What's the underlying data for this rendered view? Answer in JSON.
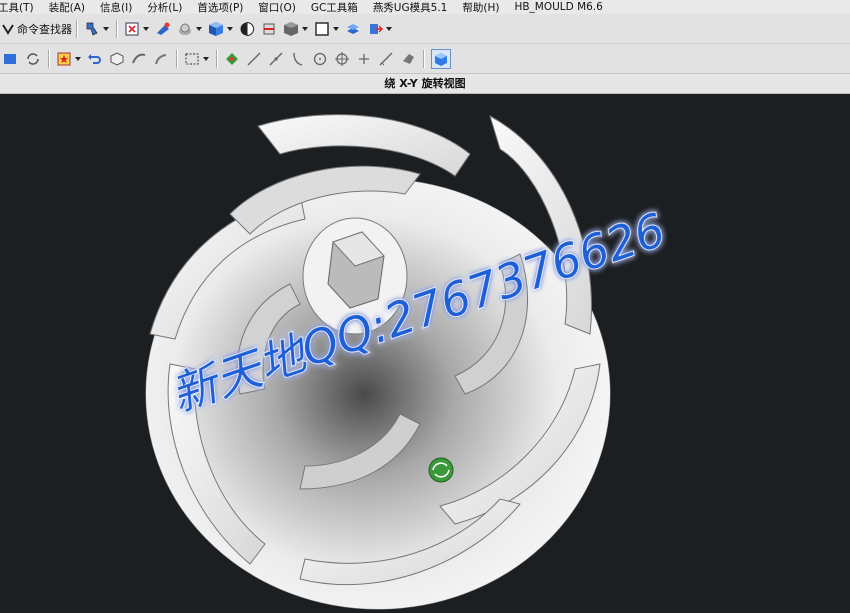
{
  "menu": {
    "items": [
      "工具(T)",
      "装配(A)",
      "信息(I)",
      "分析(L)",
      "首选项(P)",
      "窗口(O)",
      "GC工具箱",
      "燕秀UG模具5.1",
      "帮助(H)",
      "HB_MOULD M6.6"
    ]
  },
  "toolbar": {
    "command_finder_label": "命令查找器"
  },
  "view": {
    "title": "绕 X-Y 旋转视图"
  },
  "watermark": {
    "text": "新天地QQ:2767376626",
    "color": "#1a5fd6"
  },
  "colors": {
    "viewport_bg": "#1c1f22",
    "toolbar_bg": "#e2e2e2",
    "cursor_green": "#3b9a3b"
  },
  "icons": [
    "filter-icon",
    "snap-point-icon",
    "view-orient-icon",
    "shaded-cube-icon",
    "render-style-icon",
    "hidden-edge-icon",
    "box-select-icon",
    "line-icon",
    "arc-icon",
    "circle-icon",
    "point-icon",
    "rotate-cursor-icon"
  ]
}
